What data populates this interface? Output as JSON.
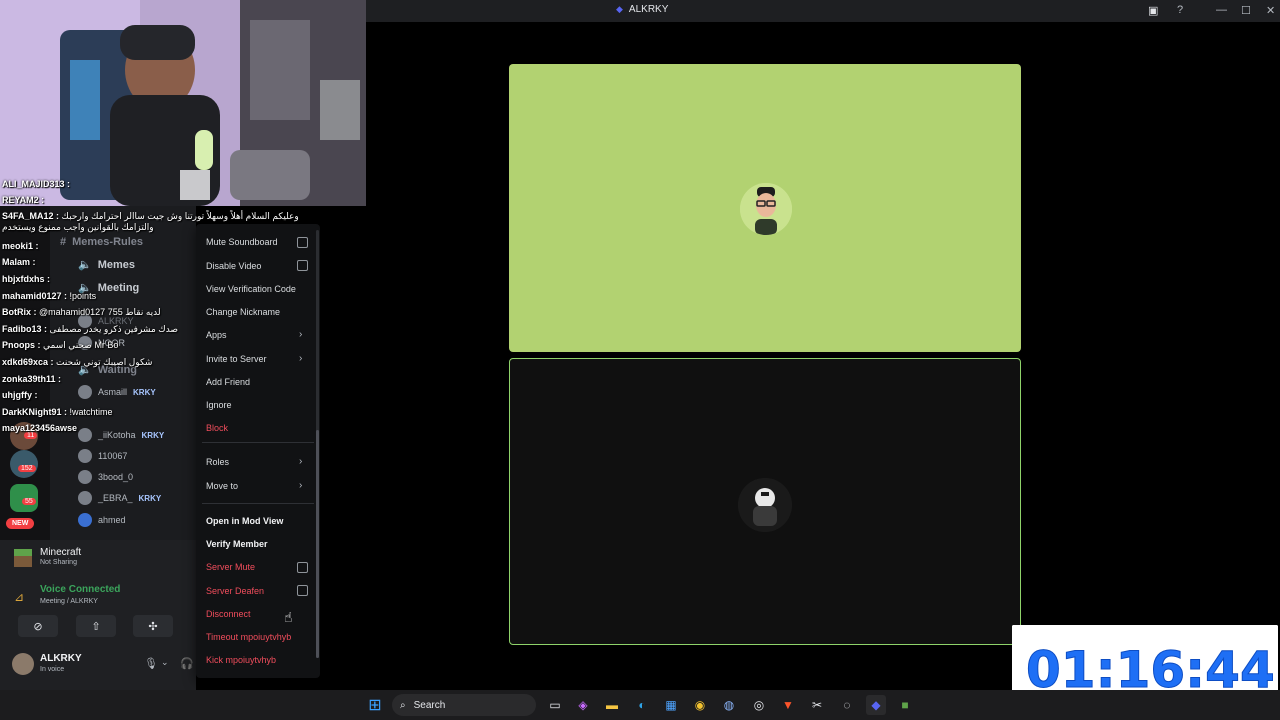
{
  "window": {
    "title": "ALKRKY"
  },
  "channels": {
    "rules": "Memes-Rules",
    "memes": "Memes",
    "meeting": "Meeting",
    "waiting": "Waiting"
  },
  "members": [
    {
      "name": "ALKRKY"
    },
    {
      "name": "NOOR"
    },
    {
      "name": "Asmaill",
      "tag": "KRKY"
    },
    {
      "name": "_iiKotoha",
      "tag": "KRKY"
    },
    {
      "name": "110067"
    },
    {
      "name": "3bood_0"
    },
    {
      "name": "_EBRA_",
      "tag": "KRKY"
    },
    {
      "name": "ahmed"
    }
  ],
  "chat": [
    {
      "user": "ALI_MAJID313 :",
      "msg": ""
    },
    {
      "user": "REYAM2 :",
      "msg": ""
    },
    {
      "user": "S4FA_MA12 :",
      "msg": "وعليكم السلام أهلاً وسهلاً تورتنا وش جيت ساالر احترامك وارحبك والتزامك بالقوانين واجب ممنوع ويستخدم"
    },
    {
      "user": "meoki1 :",
      "msg": ""
    },
    {
      "user": "Malam :",
      "msg": ""
    },
    {
      "user": "hbjxfdxhs :",
      "msg": ""
    },
    {
      "user": "mahamid0127 :",
      "msg": "!points"
    },
    {
      "user": "BotRix :",
      "msg": "@mahamid0127 755 لديه نقاط"
    },
    {
      "user": "Fadibo13 :",
      "msg": "صدك مشرفين ذكرو يخدر مصطفى"
    },
    {
      "user": "Pnoops :",
      "msg": "صحني اسمي Mr Bo"
    },
    {
      "user": "xdkd69xca :",
      "msg": "شكول اصيبك توني شحنت"
    },
    {
      "user": "zonka39th11 :",
      "msg": ""
    },
    {
      "user": "uhjgffy :",
      "msg": ""
    },
    {
      "user": "DarkKNight91 :",
      "msg": "!watchtime"
    },
    {
      "user": "maya123456awse",
      "msg": ""
    }
  ],
  "menu": {
    "mute_soundboard": "Mute Soundboard",
    "disable_video": "Disable Video",
    "view_verification_code": "View Verification Code",
    "change_nickname": "Change Nickname",
    "apps": "Apps",
    "invite_to_server": "Invite to Server",
    "add_friend": "Add Friend",
    "ignore": "Ignore",
    "block": "Block",
    "roles": "Roles",
    "move_to": "Move to",
    "open_in_mod_view": "Open in Mod View",
    "verify_member": "Verify Member",
    "server_mute": "Server Mute",
    "server_deafen": "Server Deafen",
    "disconnect": "Disconnect",
    "timeout": "Timeout mpoiuytvhyb",
    "kick": "Kick mpoiuytvhyb"
  },
  "activity": {
    "game": "Minecraft",
    "game_status": "Not Sharing",
    "voice_status": "Voice Connected",
    "voice_channel": "Meeting / ALKRKY"
  },
  "user": {
    "name": "ALKRKY",
    "status": "In voice"
  },
  "server_badges": {
    "new": "NEW",
    "count_a": "11",
    "count_b": "152",
    "count_c": "55"
  },
  "timer": {
    "value": "01:16:44"
  },
  "taskbar": {
    "search_label": "Search"
  },
  "colors": {
    "tile_top_bg": "#b2d271",
    "tile_bottom_border": "#8fd36a",
    "danger": "#f04d5c",
    "voice_green": "#3ba55c",
    "timer_blue": "#1e6ff5"
  }
}
